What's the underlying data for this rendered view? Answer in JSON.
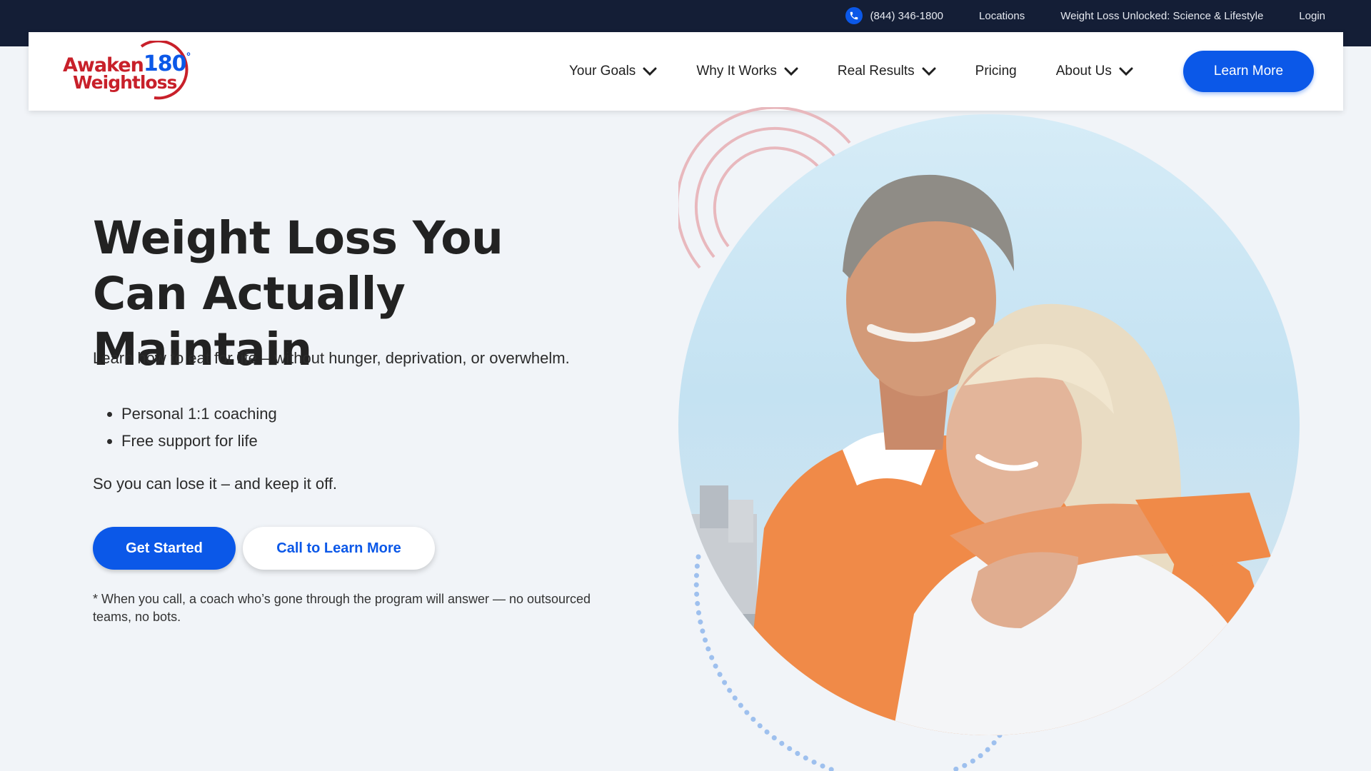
{
  "topbar": {
    "phone": "(844) 346-1800",
    "links": [
      "Locations",
      "Weight Loss Unlocked: Science & Lifestyle",
      "Login"
    ]
  },
  "brand": {
    "line1_a": "Awaken",
    "line1_b": "180",
    "degree": "°",
    "line2": "Weightloss"
  },
  "nav": {
    "items": [
      {
        "label": "Your Goals"
      },
      {
        "label": "Why It Works"
      },
      {
        "label": "Real Results"
      },
      {
        "label": "Pricing"
      },
      {
        "label": "About Us"
      }
    ],
    "cta": "Learn More"
  },
  "hero": {
    "title": "Weight Loss You Can Actually Maintain",
    "description": "Learn how to eat for life – without hunger, deprivation, or overwhelm.",
    "bullets": [
      "Personal 1:1 coaching",
      "Free support for life"
    ],
    "tagline": "So you can lose it – and keep it off.",
    "primary_button": "Get Started",
    "secondary_button": "Call to Learn More",
    "note": "* When you call, a coach who’s gone through the program will answer — no outsourced teams, no bots."
  },
  "colors": {
    "accent": "#0b58e8",
    "brand_red": "#c8202a",
    "topbar": "#141e36",
    "background": "#f1f4f8"
  },
  "icons": {
    "phone": "phone-icon",
    "dropdown": "chevron-down-icon"
  }
}
